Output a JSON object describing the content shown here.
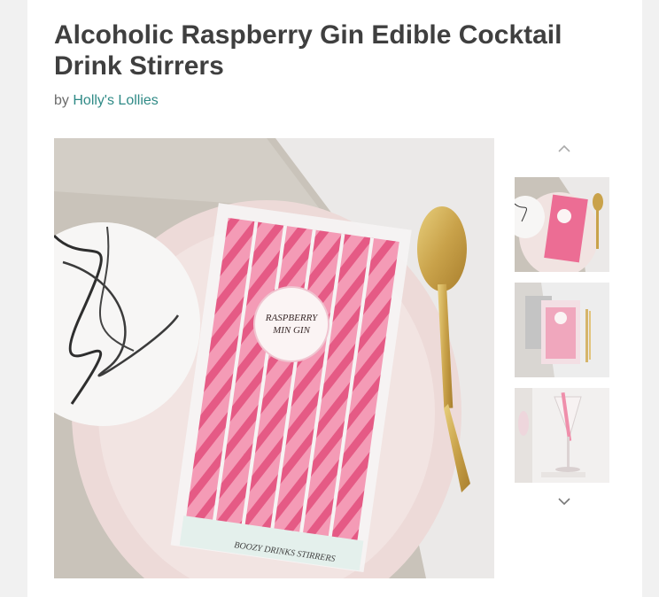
{
  "product": {
    "title": "Alcoholic Raspberry Gin Edible Cocktail Drink Stirrers",
    "by_prefix": "by",
    "shop_name": "Holly's Lollies"
  },
  "image": {
    "label_line1": "RASPBERRY",
    "label_line2": "MIN GIN",
    "footer_text": "BOOZY DRINKS STIRRERS"
  },
  "gallery": {
    "up_icon": "chevron-up-icon",
    "down_icon": "chevron-down-icon",
    "thumbnail_count": 3
  },
  "colors": {
    "title": "#3f3f3f",
    "shop_link": "#2f8a86",
    "stirrer_pink": "#f07a9c"
  }
}
